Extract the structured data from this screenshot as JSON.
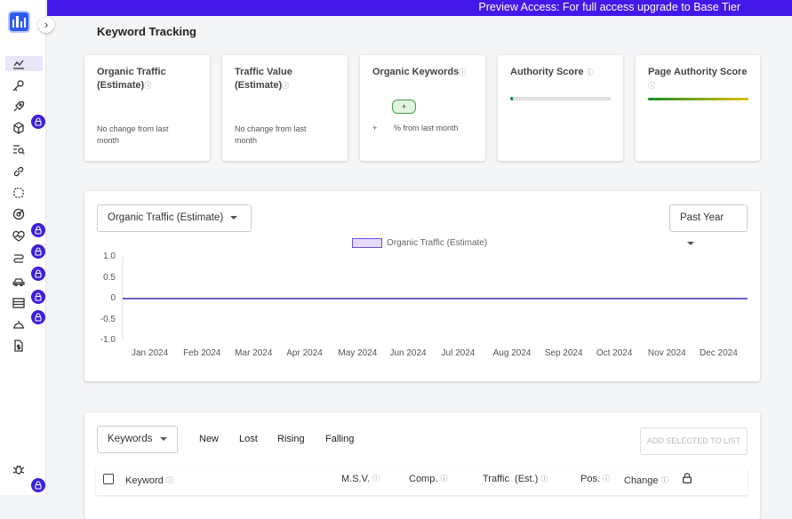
{
  "banner": {
    "text": "Preview Access: For full access upgrade to Base Tier"
  },
  "sidebar": {
    "collapse_glyph": "›",
    "items": [
      {
        "icon": "trend-chart-icon",
        "active": true,
        "locked": false
      },
      {
        "icon": "key-icon",
        "locked": false
      },
      {
        "icon": "rocket-icon",
        "locked": false
      },
      {
        "icon": "cube-icon",
        "locked": true
      },
      {
        "icon": "search-list-icon",
        "locked": false
      },
      {
        "icon": "link-icon",
        "locked": false
      },
      {
        "icon": "broken-link-icon",
        "locked": false
      },
      {
        "icon": "target-icon",
        "locked": false
      },
      {
        "icon": "heart-pulse-icon",
        "locked": true
      },
      {
        "icon": "route-icon",
        "locked": true
      },
      {
        "icon": "car-icon",
        "locked": true
      },
      {
        "icon": "table-icon",
        "locked": true
      },
      {
        "icon": "cloche-icon",
        "locked": true
      },
      {
        "icon": "document-dollar-icon",
        "locked": false
      }
    ],
    "bottom": {
      "icon": "bug-icon",
      "locked": true
    }
  },
  "page": {
    "title": "Keyword Tracking"
  },
  "metrics": [
    {
      "title_line1": "Organic Traffic",
      "title_line2": "(Estimate)",
      "sub_line1": "No change from last",
      "sub_line2": "month"
    },
    {
      "title_line1": "Traffic Value",
      "title_line2": "(Estimate)",
      "sub_line1": "No change from last",
      "sub_line2": "month"
    },
    {
      "title": "Organic Keywords",
      "pill": "+",
      "plus": "+",
      "sub": "% from last month"
    },
    {
      "title": "Authority Score",
      "progress": 0.03,
      "bar_color": "#1a8a4a"
    },
    {
      "title": "Page Authority Score",
      "progress": 1.0,
      "bar_colors": [
        "#1a8a2a",
        "#e0c000"
      ]
    }
  ],
  "info_glyph": "ⓘ",
  "chart_controls": {
    "metric_select": "Organic Traffic (Estimate)",
    "period_select": "Past Year"
  },
  "chart_data": {
    "type": "line",
    "series": [
      {
        "name": "Organic Traffic (Estimate)",
        "color": "#3a2ec4",
        "values": [
          0,
          0,
          0,
          0,
          0,
          0,
          0,
          0,
          0,
          0,
          0,
          0
        ]
      }
    ],
    "categories": [
      "Jan 2024",
      "Feb 2024",
      "Mar 2024",
      "Apr 2024",
      "May 2024",
      "Jun 2024",
      "Jul 2024",
      "Aug 2024",
      "Sep 2024",
      "Oct 2024",
      "Nov 2024",
      "Dec 2024"
    ],
    "y_ticks": [
      "1.0",
      "0.5",
      "0",
      "-0.5",
      "-1.0"
    ],
    "ylim": [
      -1.0,
      1.0
    ],
    "grid": false,
    "legend": "top-center"
  },
  "table": {
    "select": "Keywords",
    "filters": [
      "New",
      "Lost",
      "Rising",
      "Falling"
    ],
    "add_button": "ADD SELECTED TO LIST",
    "columns": [
      "Keyword",
      "M.S.V.",
      "Comp.",
      "Traffic  (Est.)",
      "Pos.",
      "Change"
    ]
  }
}
